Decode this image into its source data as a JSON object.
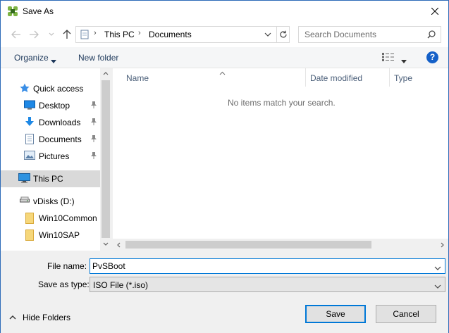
{
  "window": {
    "title": "Save As"
  },
  "navigation": {
    "path": [
      "This PC",
      "Documents"
    ],
    "search_placeholder": "Search Documents"
  },
  "toolbar": {
    "organize_label": "Organize",
    "new_folder_label": "New folder",
    "help_label": "?"
  },
  "sidebar": {
    "items": [
      {
        "label": "Quick access",
        "icon": "star-icon"
      },
      {
        "label": "Desktop",
        "icon": "desktop-icon",
        "pinned": true
      },
      {
        "label": "Downloads",
        "icon": "download-icon",
        "pinned": true
      },
      {
        "label": "Documents",
        "icon": "documents-icon",
        "pinned": true
      },
      {
        "label": "Pictures",
        "icon": "pictures-icon",
        "pinned": true
      },
      {
        "label": "This PC",
        "icon": "computer-icon",
        "selected": true
      },
      {
        "label": "vDisks (D:)",
        "icon": "drive-icon"
      },
      {
        "label": "Win10Common",
        "icon": "folder-icon"
      },
      {
        "label": "Win10SAP",
        "icon": "folder-icon"
      }
    ]
  },
  "file_list": {
    "columns": [
      "Name",
      "Date modified",
      "Type"
    ],
    "empty_message": "No items match your search."
  },
  "form": {
    "file_name_label": "File name:",
    "file_name_value": "PvSBoot",
    "save_type_label": "Save as type:",
    "save_type_value": "ISO File (*.iso)",
    "hide_folders_label": "Hide Folders",
    "save_label": "Save",
    "cancel_label": "Cancel"
  },
  "colors": {
    "accent": "#0078d7",
    "selection": "#d9d9d9",
    "link_text": "#1e395b",
    "help_blue": "#1460c8"
  }
}
